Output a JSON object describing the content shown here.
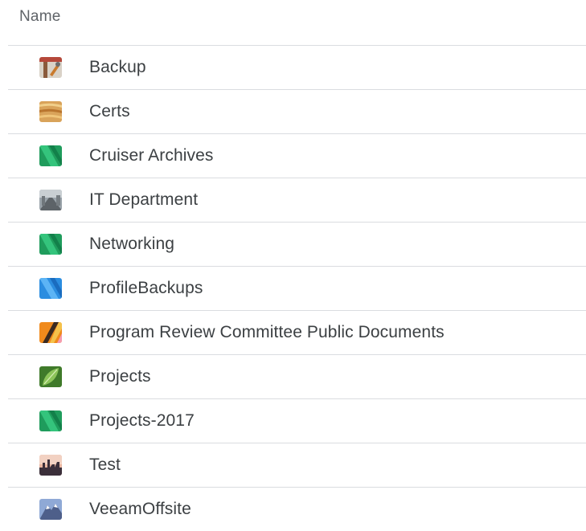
{
  "column_header": "Name",
  "rows": [
    {
      "label": "Backup",
      "icon": "tools-thumbnail-icon"
    },
    {
      "label": "Certs",
      "icon": "sand-waves-thumbnail-icon"
    },
    {
      "label": "Cruiser Archives",
      "icon": "green-stripes-thumbnail-icon"
    },
    {
      "label": "IT Department",
      "icon": "street-photo-thumbnail-icon"
    },
    {
      "label": "Networking",
      "icon": "green-stripes-thumbnail-icon"
    },
    {
      "label": "ProfileBackups",
      "icon": "blue-stripes-thumbnail-icon"
    },
    {
      "label": "Program Review Committee Public Documents",
      "icon": "orange-stripes-thumbnail-icon"
    },
    {
      "label": "Projects",
      "icon": "leaf-thumbnail-icon"
    },
    {
      "label": "Projects-2017",
      "icon": "green-stripes-thumbnail-icon"
    },
    {
      "label": "Test",
      "icon": "city-skyline-thumbnail-icon"
    },
    {
      "label": "VeeamOffsite",
      "icon": "mountain-thumbnail-icon"
    }
  ]
}
